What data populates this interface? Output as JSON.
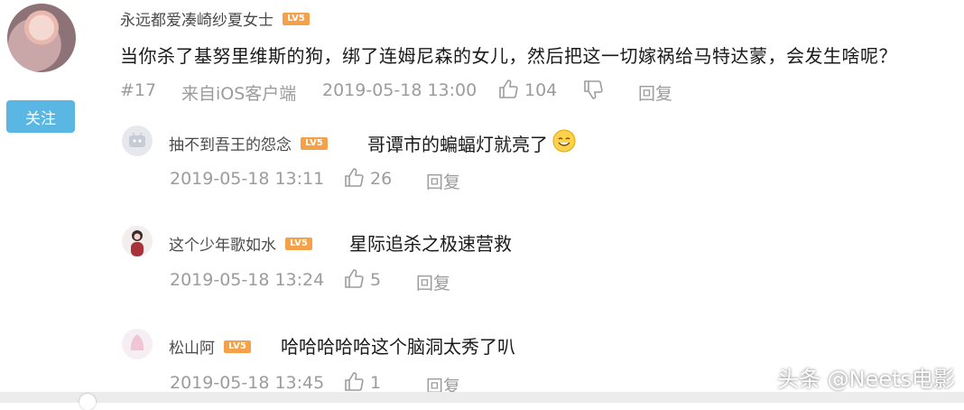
{
  "main_comment": {
    "username": "永远都爱凑崎纱夏女士",
    "level_badge": "LV5",
    "text": "当你杀了基努里维斯的狗，绑了连姆尼森的女儿，然后把这一切嫁祸给马特达蒙，会发生啥呢？",
    "floor": "#17",
    "source": "来自iOS客户端",
    "timestamp": "2019-05-18 13:00",
    "likes": "104",
    "reply_label": "回复",
    "follow_label": "关注"
  },
  "replies": [
    {
      "username": "抽不到吾王的怨念",
      "level_badge": "LV5",
      "text": "哥谭市的蝙蝠灯就亮了",
      "timestamp": "2019-05-18 13:11",
      "likes": "26",
      "reply_label": "回复"
    },
    {
      "username": "这个少年歌如水",
      "level_badge": "LV5",
      "text": "星际追杀之极速营救",
      "timestamp": "2019-05-18 13:24",
      "likes": "5",
      "reply_label": "回复"
    },
    {
      "username": "松山阿",
      "level_badge": "LV5",
      "text": "哈哈哈哈哈这个脑洞太秀了叭",
      "timestamp": "2019-05-18 13:45",
      "likes": "1",
      "reply_label": "回复"
    }
  ],
  "watermark": "头条 @Neets电影",
  "colors": {
    "follow_button": "#5ab6e3",
    "level_badge": "#f4a14a",
    "meta_text": "#9c9c9c"
  }
}
